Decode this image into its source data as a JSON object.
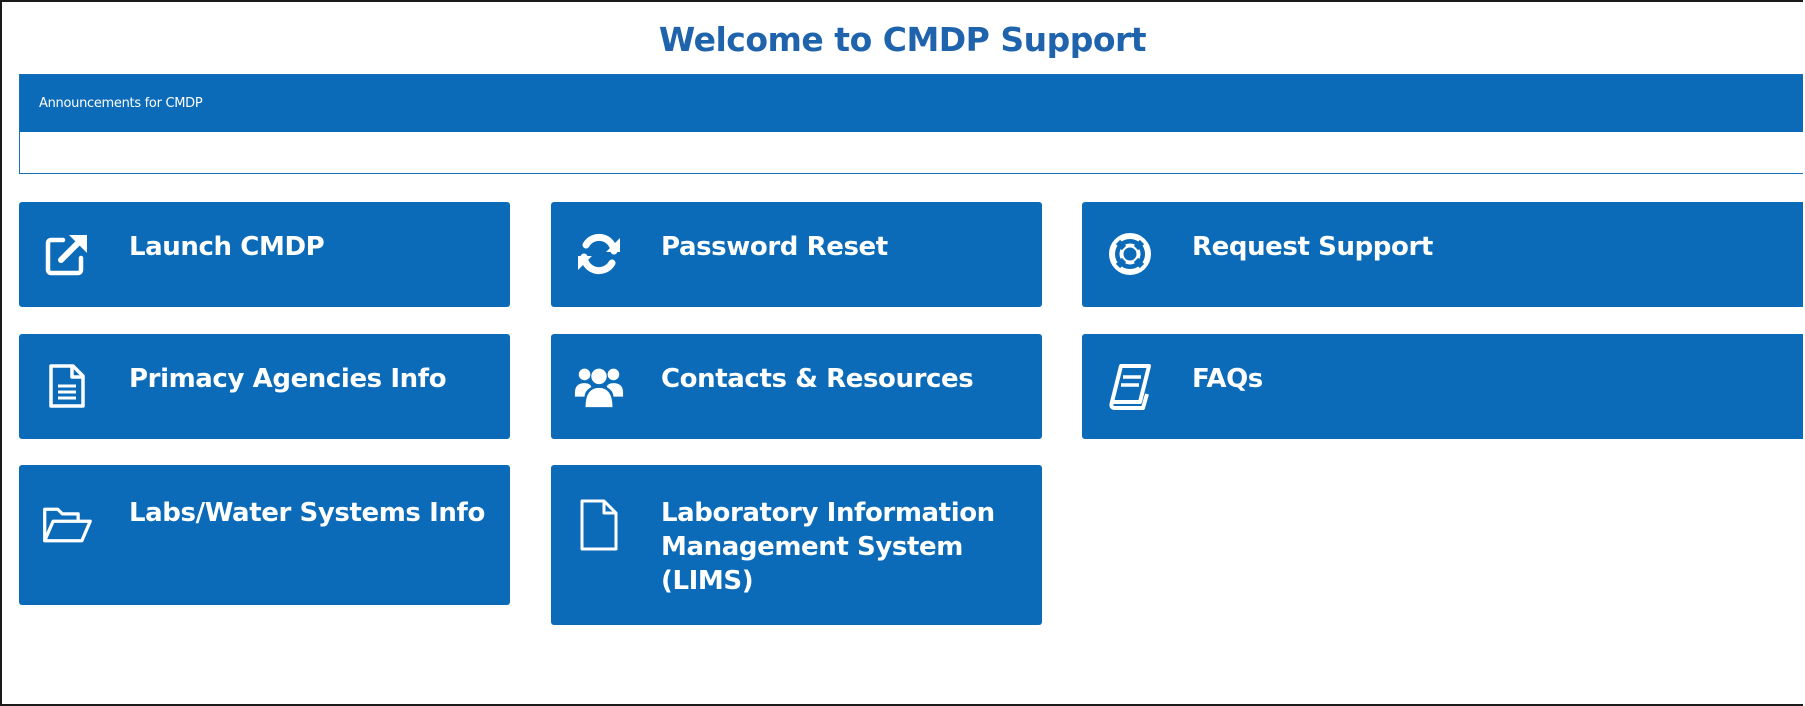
{
  "header": {
    "title": "Welcome to CMDP Support"
  },
  "announcements": {
    "title": "Announcements for CMDP",
    "body": ""
  },
  "tiles": [
    {
      "label": "Launch CMDP",
      "icon": "external-link-icon"
    },
    {
      "label": "Password Reset",
      "icon": "refresh-icon"
    },
    {
      "label": "Request Support",
      "icon": "life-ring-icon"
    },
    {
      "label": "Primacy Agencies Info",
      "icon": "document-icon"
    },
    {
      "label": "Contacts & Resources",
      "icon": "users-icon"
    },
    {
      "label": "FAQs",
      "icon": "book-icon"
    },
    {
      "label": "Labs/Water Systems Info",
      "icon": "folder-open-icon"
    },
    {
      "label": "Laboratory Information Management System (LIMS)",
      "icon": "file-icon"
    }
  ],
  "colors": {
    "brand_blue": "#0b6bb8",
    "title_blue": "#1f63ad",
    "tile_text": "#ffffff"
  }
}
